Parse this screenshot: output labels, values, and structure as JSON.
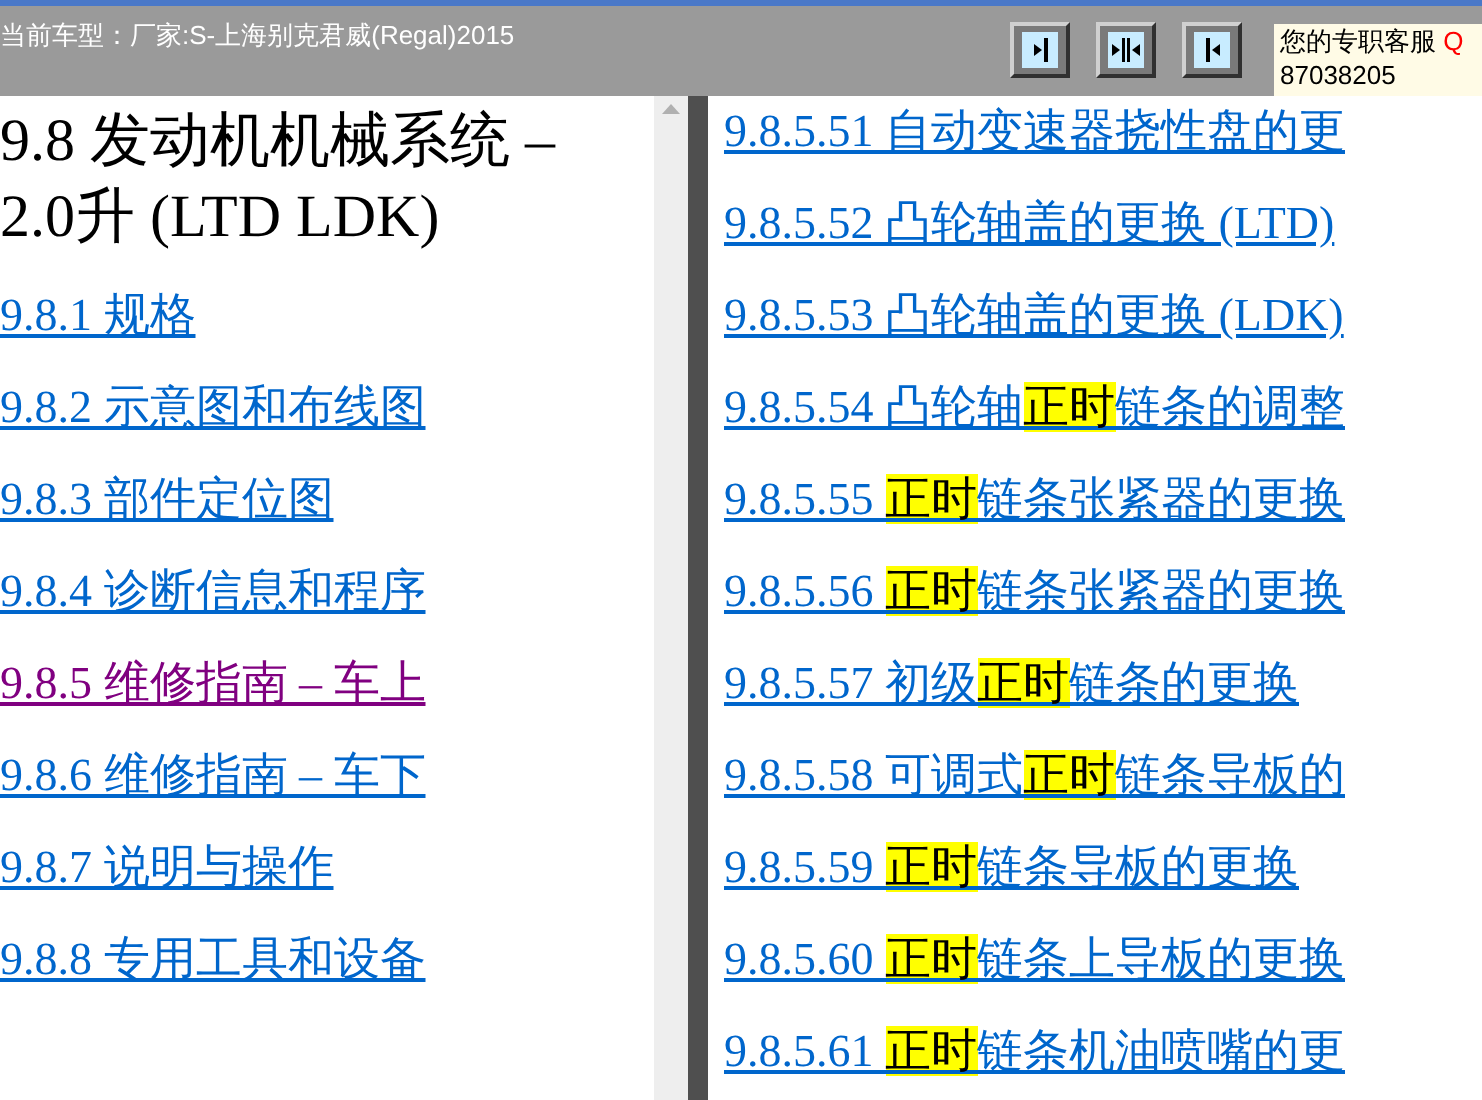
{
  "header": {
    "model_label": "当前车型：厂家:S-上海别克君威(Regal)2015",
    "service_label": "您的专职客服",
    "service_qq": "Q",
    "service_phone": "87038205"
  },
  "toolbar": [
    {
      "kind": "right"
    },
    {
      "kind": "both"
    },
    {
      "kind": "left"
    }
  ],
  "left_pane": {
    "title": "9.8 发动机机械系统 – 2.0升 (LTD LDK)",
    "links": [
      {
        "text": "9.8.1 规格",
        "visited": false
      },
      {
        "text": "9.8.2 示意图和布线图",
        "visited": false
      },
      {
        "text": "9.8.3 部件定位图",
        "visited": false
      },
      {
        "text": "9.8.4 诊断信息和程序",
        "visited": false
      },
      {
        "text": "9.8.5 维修指南 – 车上",
        "visited": true
      },
      {
        "text": "9.8.6 维修指南 – 车下",
        "visited": false
      },
      {
        "text": "9.8.7 说明与操作",
        "visited": false
      },
      {
        "text": "9.8.8 专用工具和设备",
        "visited": false
      }
    ]
  },
  "right_pane": {
    "links": [
      {
        "before": "9.8.5.51 自动变速器挠性盘的更"
      },
      {
        "before": "9.8.5.52 凸轮轴盖的更换 (LTD)"
      },
      {
        "before": "9.8.5.53 凸轮轴盖的更换 (LDK)"
      },
      {
        "before": "9.8.5.54 凸轮轴",
        "highlight": "正时",
        "after": "链条的调整"
      },
      {
        "before": "9.8.5.55 ",
        "highlight": "正时",
        "after": "链条张紧器的更换"
      },
      {
        "before": "9.8.5.56 ",
        "highlight": "正时",
        "after": "链条张紧器的更换"
      },
      {
        "before": "9.8.5.57 初级",
        "highlight": "正时",
        "after": "链条的更换"
      },
      {
        "before": "9.8.5.58 可调式",
        "highlight": "正时",
        "after": "链条导板的"
      },
      {
        "before": "9.8.5.59 ",
        "highlight": "正时",
        "after": "链条导板的更换"
      },
      {
        "before": "9.8.5.60 ",
        "highlight": "正时",
        "after": "链条上导板的更换"
      },
      {
        "before": "9.8.5.61 ",
        "highlight": "正时",
        "after": "链条机油喷嘴的更"
      }
    ]
  }
}
